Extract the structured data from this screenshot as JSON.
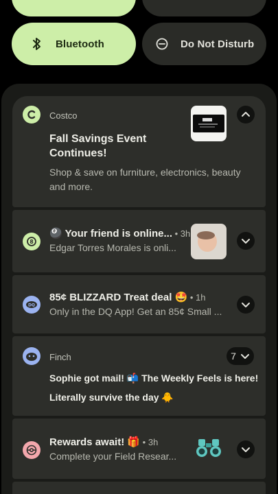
{
  "quick_tiles": {
    "bluetooth": {
      "label": "Bluetooth",
      "active": true
    },
    "dnd": {
      "label": "Do Not Disturb",
      "active": false
    }
  },
  "notifications": [
    {
      "app": "Costco",
      "title_line1": "Fall Savings Event",
      "title_line2": "Continues!",
      "body_line1": "Shop & save on furniture, electronics, beauty",
      "body_line2": "and more.",
      "expanded": true
    },
    {
      "emoji": "🎱",
      "title": "Your friend is online...",
      "time": "3h",
      "body": "Edgar Torres Morales is onli..."
    },
    {
      "title": "85¢ BLIZZARD Treat deal 🤩",
      "time": "1h",
      "body": "Only in the DQ App! Get an 85¢ Small ..."
    },
    {
      "app": "Finch",
      "count": "7",
      "line1": "Sophie got mail! 📬 The Weekly Feels is here!",
      "line2": "Literally survive the day 🐥"
    },
    {
      "title": "Rewards await! 🎁",
      "time": "3h",
      "body": "Complete your Field Resear..."
    }
  ],
  "colors": {
    "accent_green": "#cdeea8",
    "card_bg": "#2d2e2a",
    "shade_bg": "#1a1b18"
  }
}
